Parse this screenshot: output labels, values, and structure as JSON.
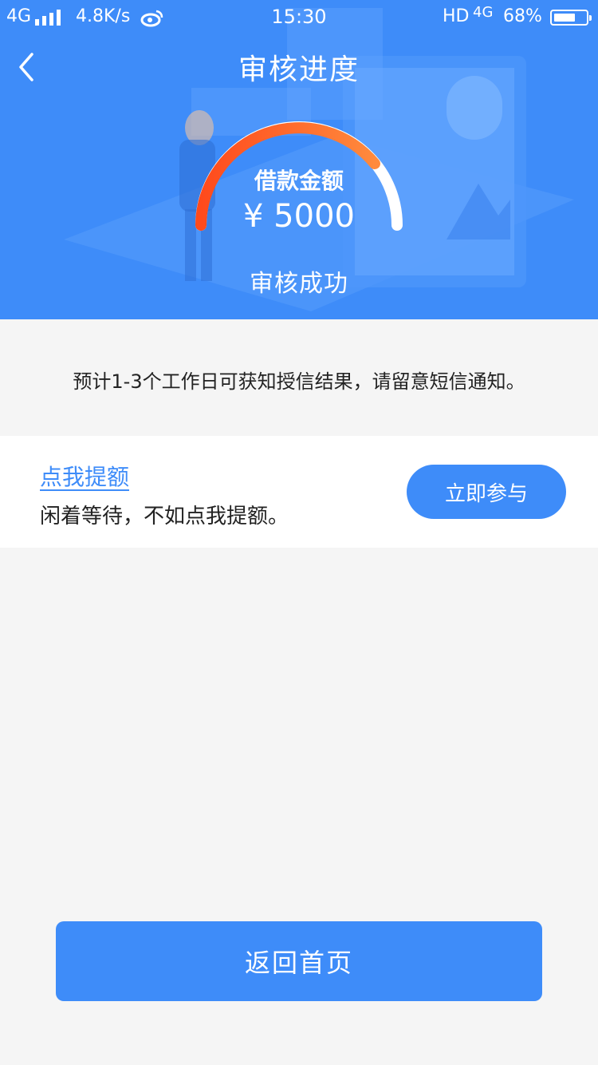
{
  "status_bar": {
    "network": "4G",
    "speed": "4.8K/s",
    "time": "15:30",
    "hd": "HD",
    "network_right": "4G",
    "battery": "68%",
    "battery_level": 0.68
  },
  "header": {
    "title": "审核进度",
    "back_icon": "chevron-left-icon"
  },
  "loan": {
    "label": "借款金额",
    "amount": "¥ 5000",
    "status": "审核成功"
  },
  "notice": {
    "text": "预计1-3个工作日可获知授信结果，请留意短信通知。"
  },
  "promo": {
    "link_text": "点我提额",
    "description": "闲着等待，不如点我提额。",
    "button_label": "立即参与"
  },
  "footer": {
    "home_button_label": "返回首页"
  },
  "colors": {
    "primary": "#3e8cf9",
    "gauge_start": "#ff4a1c",
    "gauge_end": "#ff8a3d",
    "background": "#f5f5f5"
  }
}
